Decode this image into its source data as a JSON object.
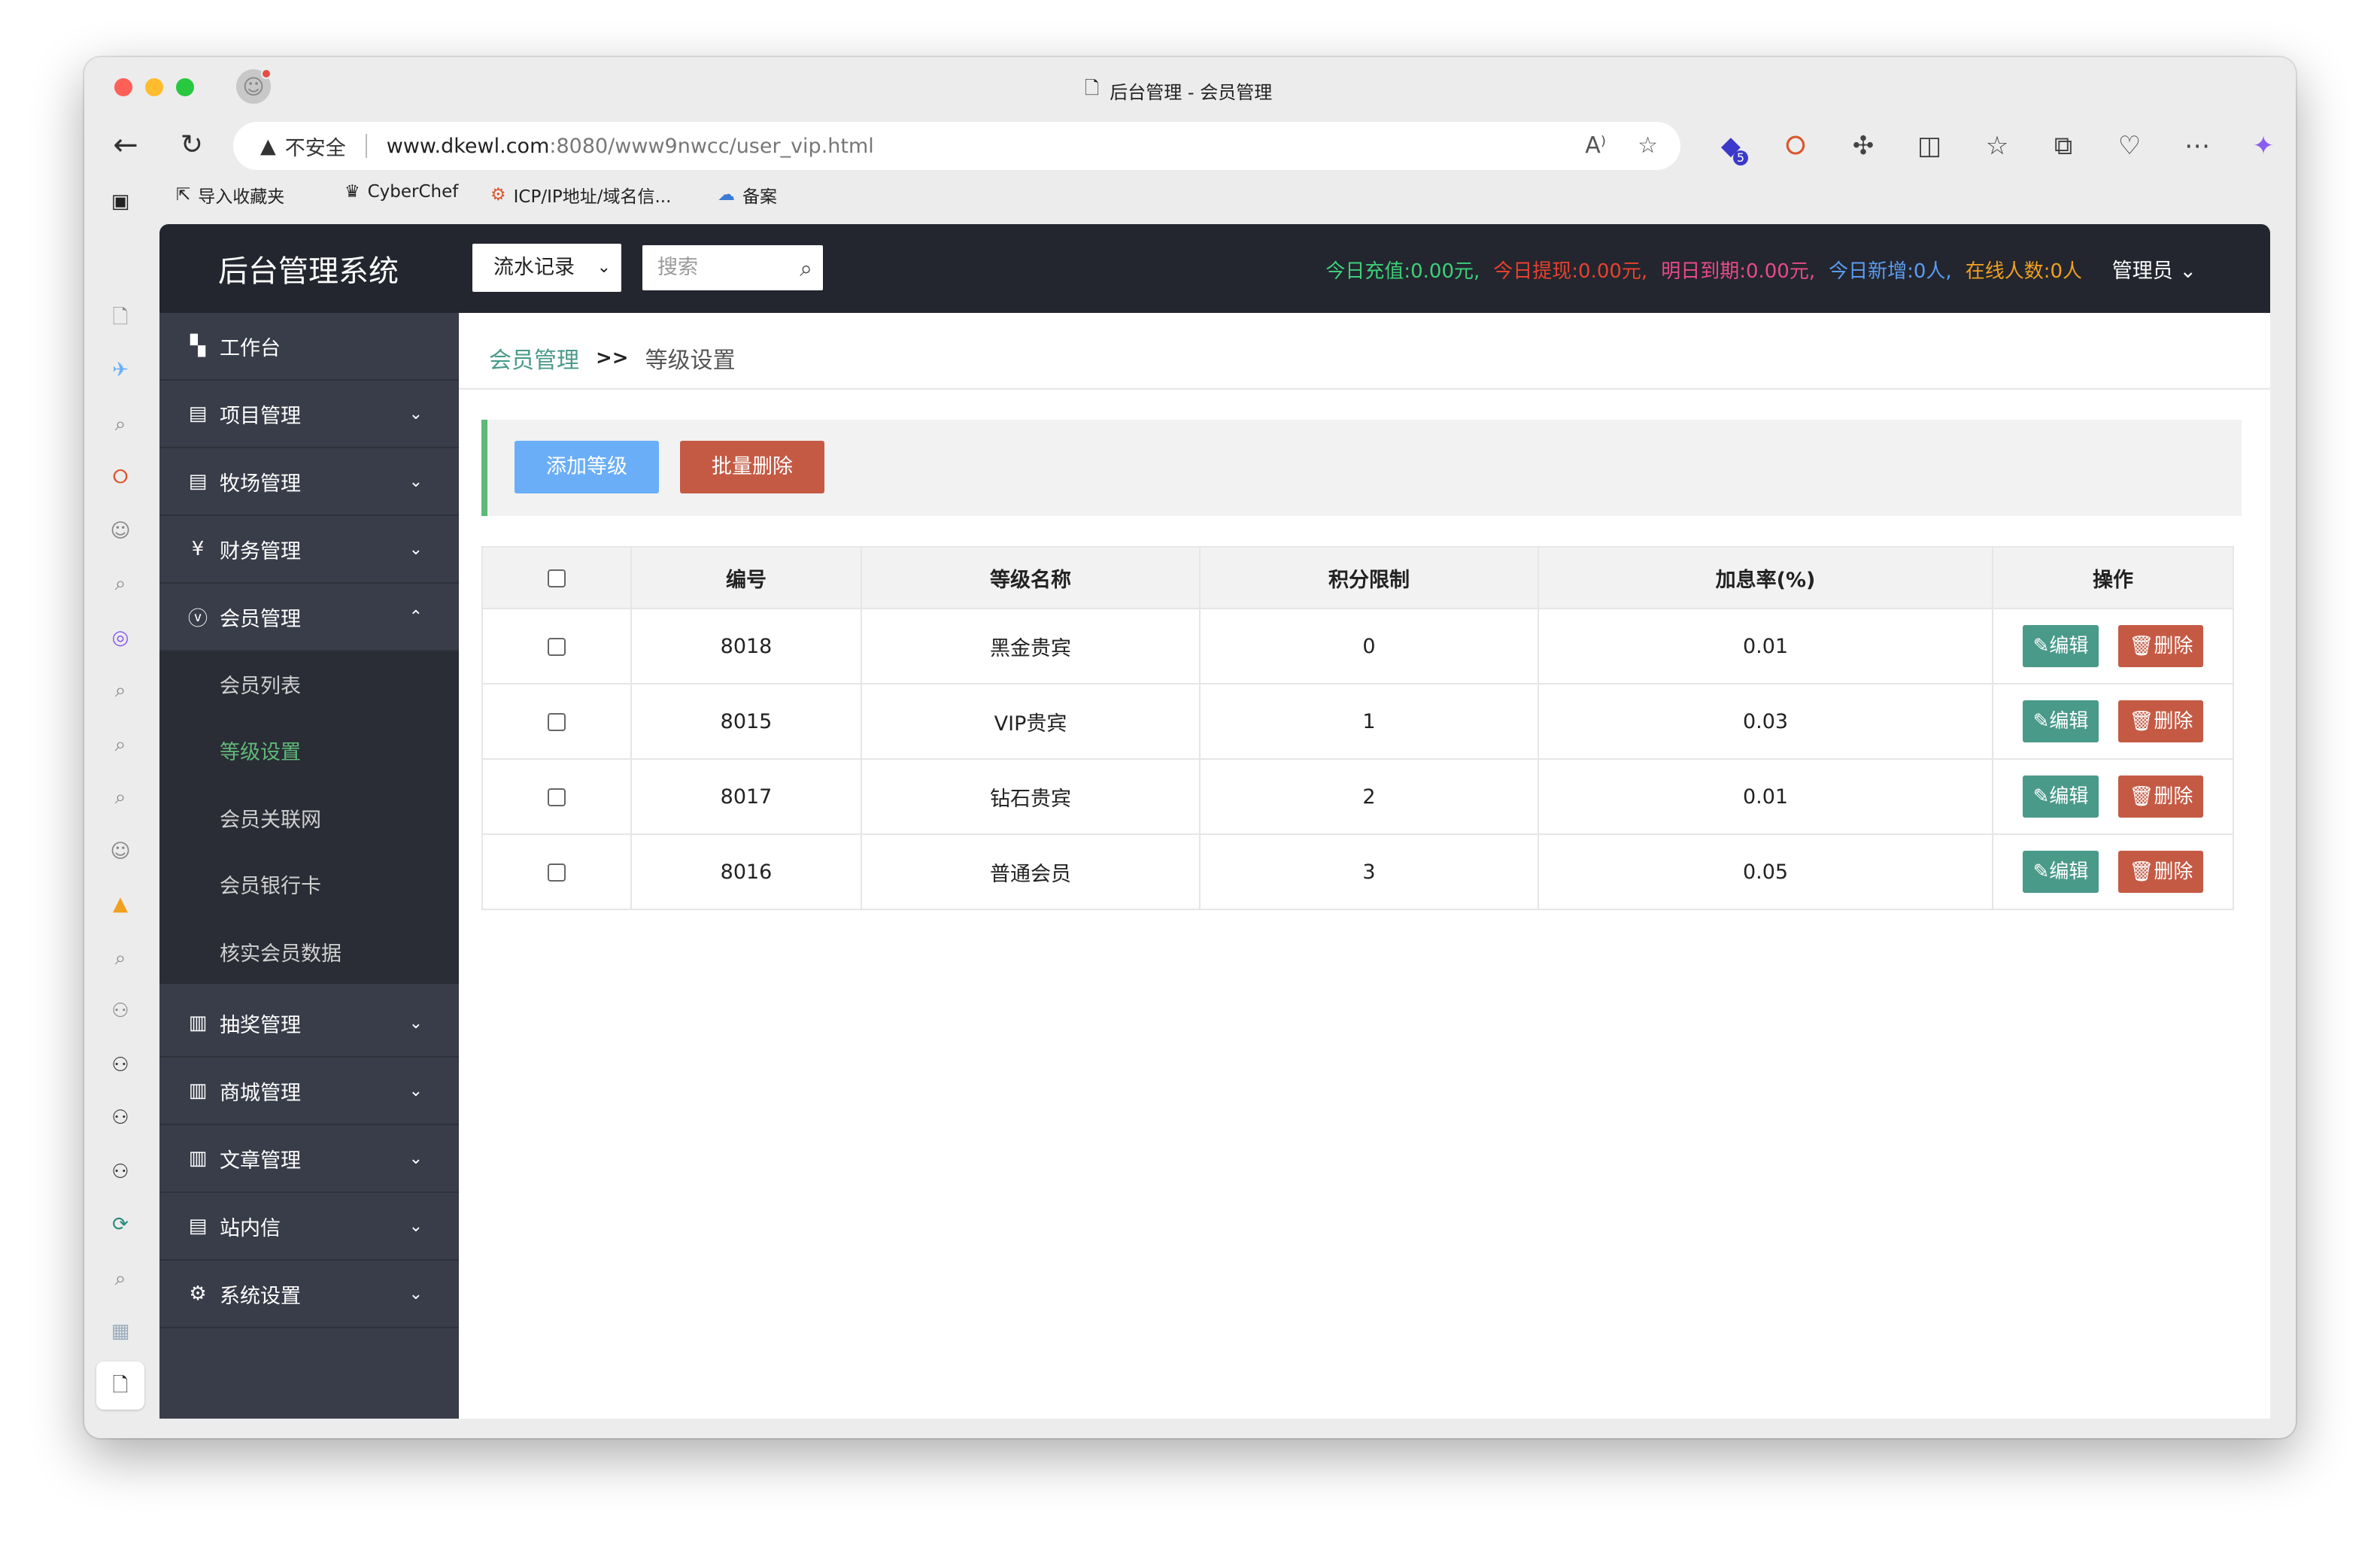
{
  "browser": {
    "tab_title": "后台管理 - 会员管理",
    "security_label": "不安全",
    "url_host": "www.dkewl.com",
    "url_path": ":8080/www9nwcc/user_vip.html",
    "extension_badge": "5",
    "bookmarks": [
      {
        "label": "导入收藏夹",
        "icon": "import-icon"
      },
      {
        "label": "CyberChef",
        "icon": "chef-icon"
      },
      {
        "label": "ICP/IP地址/域名信...",
        "icon": "gear-icon"
      },
      {
        "label": "备案",
        "icon": "cloud-icon"
      }
    ]
  },
  "header": {
    "logo": "后台管理系统",
    "select_value": "流水记录",
    "search_placeholder": "搜索",
    "stats": [
      {
        "label": "今日充值:",
        "value": "0.00元,",
        "color": "#3cd07a"
      },
      {
        "label": "今日提现:",
        "value": "0.00元,",
        "color": "#e8412f"
      },
      {
        "label": "明日到期:",
        "value": "0.00元,",
        "color": "#e84a8a"
      },
      {
        "label": "今日新增:",
        "value": "0人,",
        "color": "#5b9cf2"
      },
      {
        "label": "在线人数:",
        "value": "0人",
        "color": "#f0a020"
      }
    ],
    "admin_label": "管理员"
  },
  "sidebar": {
    "items": [
      {
        "label": "工作台",
        "icon": "dashboard-icon"
      },
      {
        "label": "项目管理",
        "icon": "clipboard-icon"
      },
      {
        "label": "牧场管理",
        "icon": "clipboard-icon"
      },
      {
        "label": "财务管理",
        "icon": "yen-icon"
      },
      {
        "label": "会员管理",
        "icon": "vip-icon"
      },
      {
        "label": "抽奖管理",
        "icon": "document-icon"
      },
      {
        "label": "商城管理",
        "icon": "document-icon"
      },
      {
        "label": "文章管理",
        "icon": "document-icon"
      },
      {
        "label": "站内信",
        "icon": "clipboard-icon"
      },
      {
        "label": "系统设置",
        "icon": "gear-icon"
      }
    ],
    "subitems": [
      "会员列表",
      "等级设置",
      "会员关联网",
      "会员银行卡",
      "核实会员数据"
    ]
  },
  "breadcrumb": {
    "parent": "会员管理",
    "separator": ">>",
    "current": "等级设置"
  },
  "actions": {
    "add_label": "添加等级",
    "batch_delete_label": "批量删除"
  },
  "table": {
    "columns": [
      "编号",
      "等级名称",
      "积分限制",
      "加息率(%)",
      "操作"
    ],
    "rows": [
      {
        "id": "8018",
        "name": "黑金贵宾",
        "points": "0",
        "rate": "0.01"
      },
      {
        "id": "8015",
        "name": "VIP贵宾",
        "points": "1",
        "rate": "0.03"
      },
      {
        "id": "8017",
        "name": "钻石贵宾",
        "points": "2",
        "rate": "0.01"
      },
      {
        "id": "8016",
        "name": "普通会员",
        "points": "3",
        "rate": "0.05"
      }
    ],
    "edit_label": "编辑",
    "delete_label": "删除"
  },
  "colors": {
    "accent_green": "#5fb878",
    "teal": "#4a9a8a",
    "danger": "#c55a44",
    "primary_blue": "#6aaef7",
    "topbar": "#23262e",
    "sidebar": "#393d49"
  }
}
